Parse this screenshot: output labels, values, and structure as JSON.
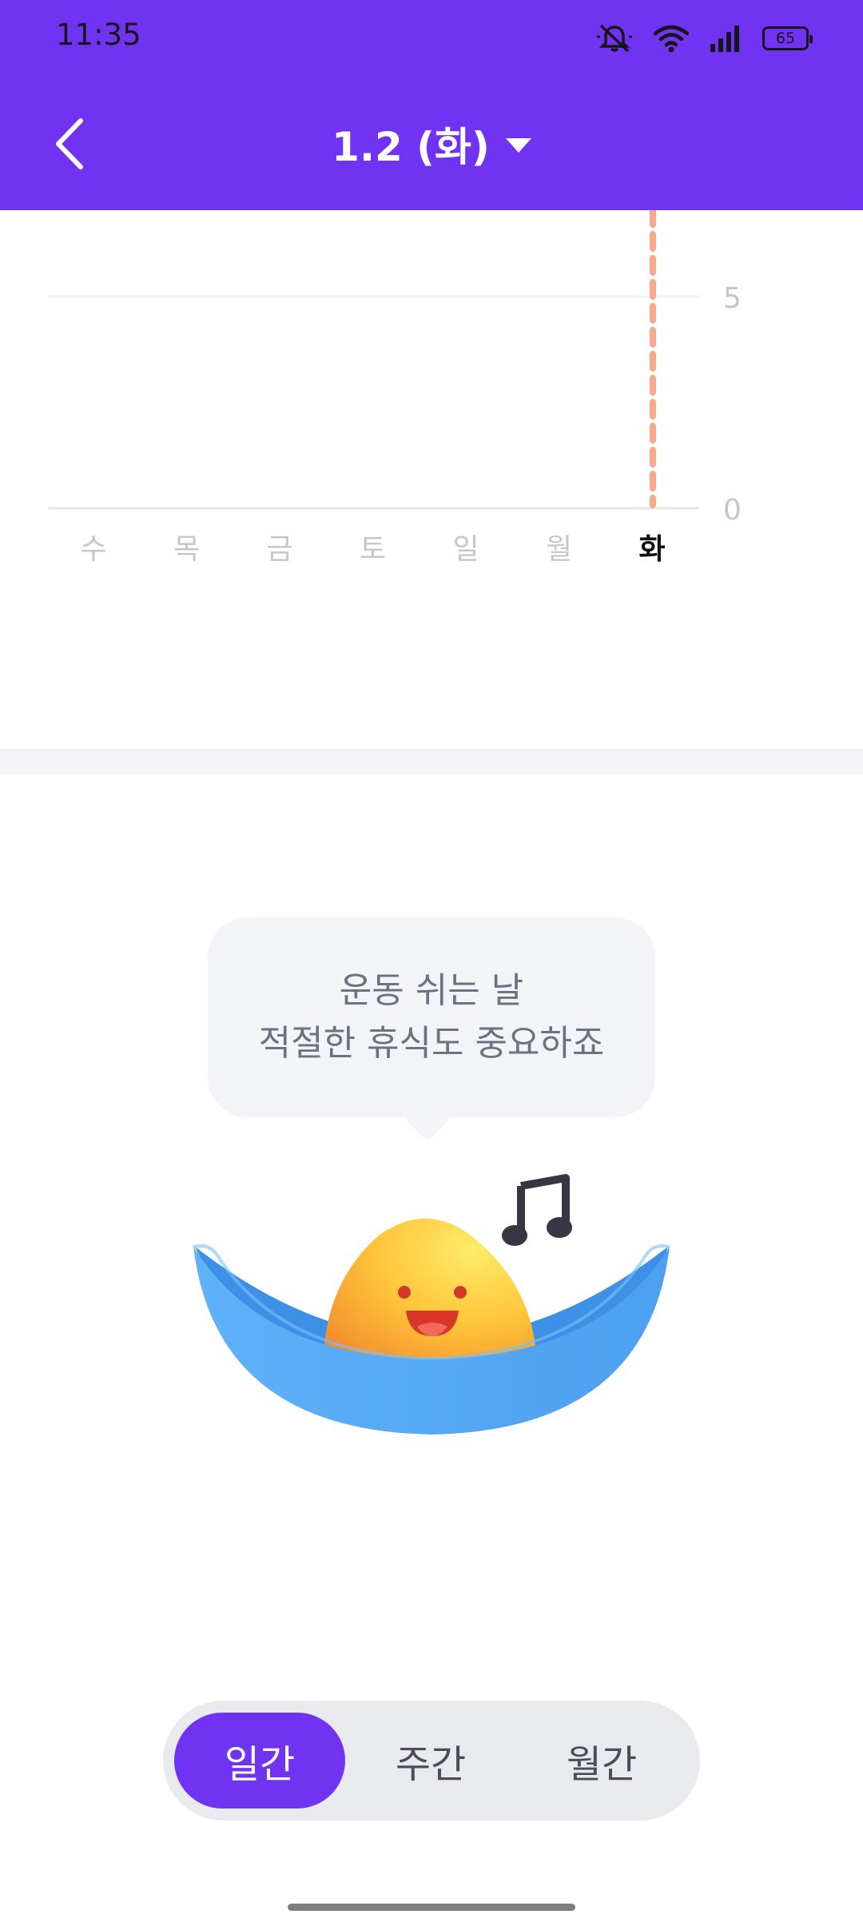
{
  "status_bar": {
    "time": "11:35",
    "battery": "65"
  },
  "header": {
    "title": "1.2 (화)",
    "accent": "#7133F2"
  },
  "chart_data": {
    "type": "bar",
    "categories": [
      "수",
      "목",
      "금",
      "토",
      "일",
      "월",
      "화"
    ],
    "values": [
      0,
      0,
      0,
      0,
      0,
      0,
      0
    ],
    "selected_category": "화",
    "y_ticks": [
      "5",
      "0"
    ],
    "ylim": [
      0,
      5
    ],
    "grid": true
  },
  "message": {
    "line1": "운동 쉬는 날",
    "line2": "적절한 휴식도 중요하죠"
  },
  "period_tabs": [
    {
      "label": "일간",
      "active": true
    },
    {
      "label": "주간",
      "active": false
    },
    {
      "label": "월간",
      "active": false
    }
  ],
  "icons": {
    "back": "chevron-left-icon",
    "dropdown": "caret-down-icon",
    "music_note": "music-note-icon"
  }
}
